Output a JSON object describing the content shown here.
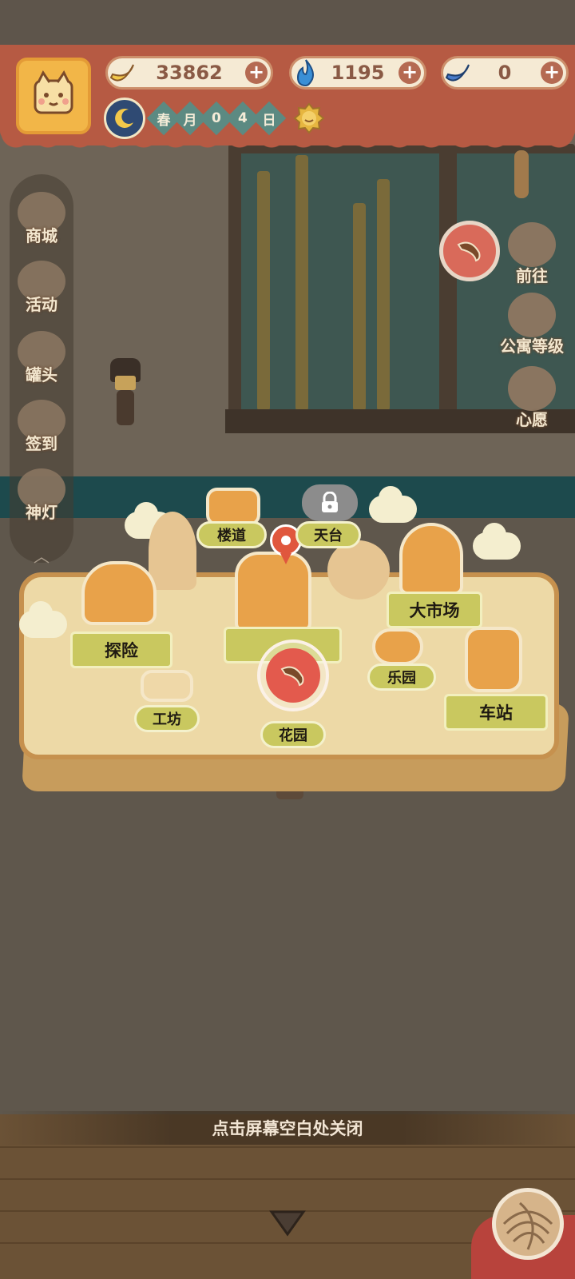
{
  "resources": [
    {
      "icon": "banana-icon",
      "value": "33862"
    },
    {
      "icon": "blue-flame-icon",
      "value": "1195"
    },
    {
      "icon": "blue-banana-icon",
      "value": "0"
    }
  ],
  "date": {
    "chars": [
      "春",
      "月",
      "0",
      "4",
      "日"
    ],
    "time_icon": "moon-icon",
    "weather_icon": "sun-icon"
  },
  "left_menu": {
    "items": [
      {
        "label": "商城",
        "icon": "shop-icon"
      },
      {
        "label": "活动",
        "icon": "gift-icon"
      },
      {
        "label": "罐头",
        "icon": "can-icon"
      },
      {
        "label": "签到",
        "icon": "calendar-icon"
      },
      {
        "label": "神灯",
        "icon": "genie-lamp-icon"
      }
    ]
  },
  "right_menu": {
    "items": [
      {
        "label": "前往",
        "icon": "map-pin-icon"
      },
      {
        "label": "公寓等级",
        "icon": "apartment-level-icon"
      },
      {
        "label": "心愿",
        "icon": "wish-book-icon"
      }
    ]
  },
  "map": {
    "locations": [
      {
        "label": "楼道"
      },
      {
        "label": "天台",
        "locked": true
      },
      {
        "label": "大市场"
      },
      {
        "label": "探险"
      },
      {
        "label": "乐园"
      },
      {
        "label": "工坊"
      },
      {
        "label": "花园"
      },
      {
        "label": "车站"
      }
    ]
  },
  "footer": {
    "close_hint": "点击屏幕空白处关闭"
  },
  "colors": {
    "topbar": "#b65a43",
    "banner": "#c9c85f",
    "pin": "#e0573d"
  }
}
